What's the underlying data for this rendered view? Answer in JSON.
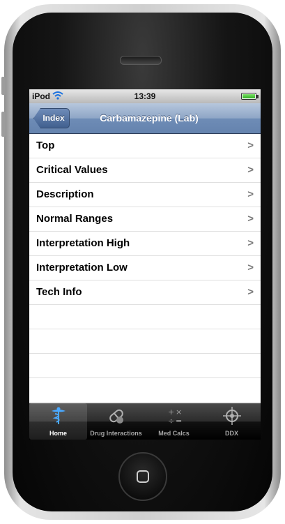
{
  "status_bar": {
    "carrier": "iPod",
    "time": "13:39"
  },
  "nav_bar": {
    "back_label": "Index",
    "title": "Carbamazepine (Lab)"
  },
  "list": {
    "items": [
      {
        "label": "Top"
      },
      {
        "label": "Critical Values"
      },
      {
        "label": "Description"
      },
      {
        "label": "Normal Ranges"
      },
      {
        "label": "Interpretation High"
      },
      {
        "label": "Interpretation Low"
      },
      {
        "label": "Tech Info"
      }
    ],
    "chevron": ">"
  },
  "tab_bar": {
    "tabs": [
      {
        "label": "Home",
        "icon": "caduceus-icon",
        "selected": true
      },
      {
        "label": "Drug Interactions",
        "icon": "pill-icon",
        "selected": false
      },
      {
        "label": "Med Calcs",
        "icon": "math-operators-icon",
        "selected": false
      },
      {
        "label": "DDX",
        "icon": "crosshair-icon",
        "selected": false
      }
    ]
  },
  "colors": {
    "nav_bar": "#6e8cb6",
    "tab_bar": "#111111",
    "battery": "#2fae22"
  }
}
